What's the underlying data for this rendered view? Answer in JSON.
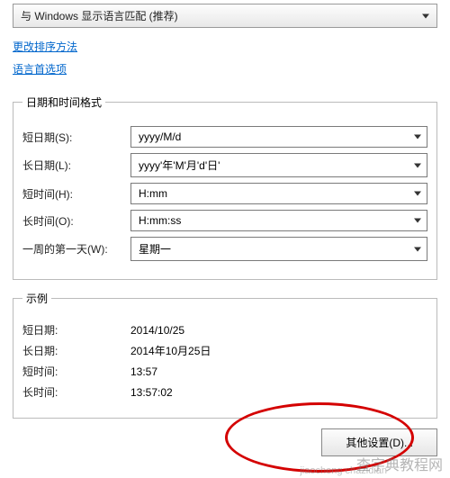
{
  "top_select": {
    "value": "与 Windows 显示语言匹配 (推荐)"
  },
  "links": {
    "sort": "更改排序方法",
    "lang": "语言首选项"
  },
  "format_group": {
    "legend": "日期和时间格式",
    "fields": [
      {
        "label": "短日期(S):",
        "value": "yyyy/M/d"
      },
      {
        "label": "长日期(L):",
        "value": "yyyy'年'M'月'd'日'"
      },
      {
        "label": "短时间(H):",
        "value": "H:mm"
      },
      {
        "label": "长时间(O):",
        "value": "H:mm:ss"
      },
      {
        "label": "一周的第一天(W):",
        "value": "星期一"
      }
    ]
  },
  "example_group": {
    "legend": "示例",
    "rows": [
      {
        "label": "短日期:",
        "value": "2014/10/25"
      },
      {
        "label": "长日期:",
        "value": "2014年10月25日"
      },
      {
        "label": "短时间:",
        "value": "13:57"
      },
      {
        "label": "长时间:",
        "value": "13:57:02"
      }
    ]
  },
  "button": {
    "other": "其他设置(D)..."
  },
  "watermark": {
    "main": "查字典教程网",
    "sub": "jiaocheng chazidian"
  }
}
